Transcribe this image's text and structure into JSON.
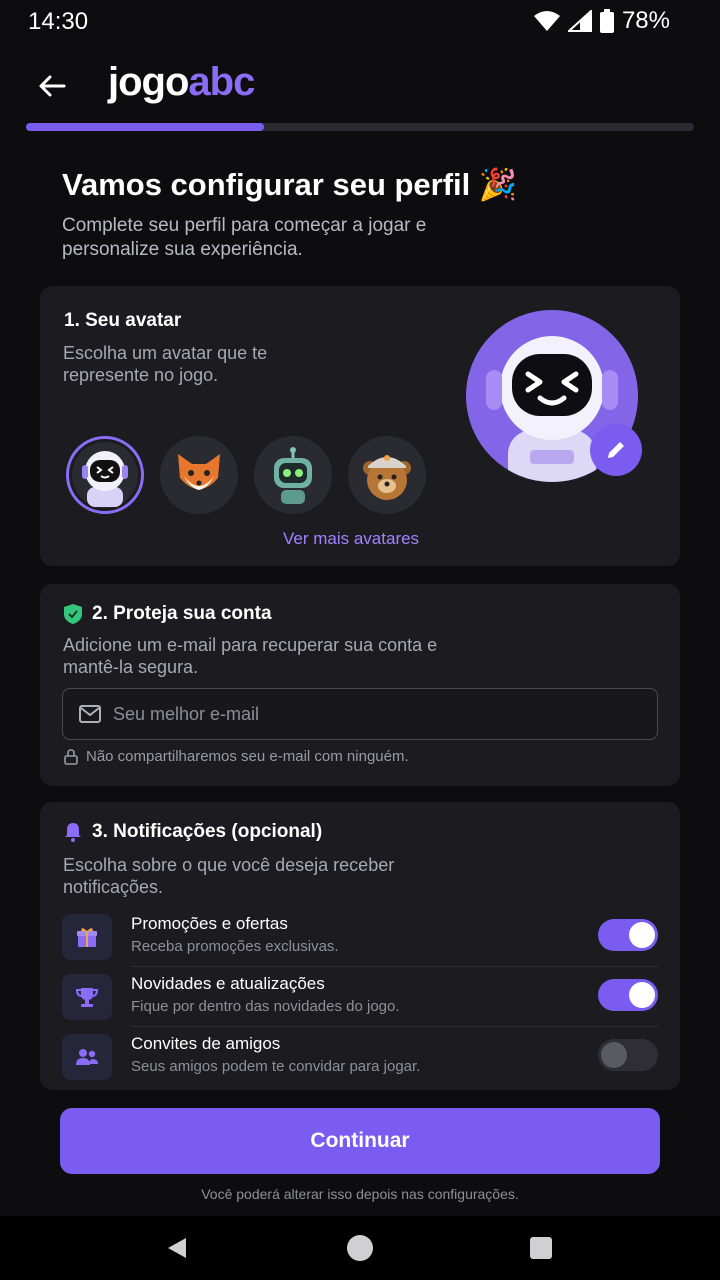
{
  "status_bar": {
    "time": "14:30",
    "battery": "78%",
    "icons": [
      "wifi-icon",
      "signal-icon",
      "battery-icon"
    ]
  },
  "header": {
    "logo_part1": "jogo",
    "logo_part2": "abc",
    "back_icon": "arrow-left-icon"
  },
  "progress": {
    "fraction": 0.356
  },
  "page": {
    "title": "Vamos configurar seu perfil 🎉",
    "subtitle": "Complete seu perfil para começar a jogar e personalize sua experiência."
  },
  "avatar_section": {
    "title": "1. Seu avatar",
    "description": "Escolha um avatar que te represente no jogo.",
    "options": [
      {
        "name": "astronaut",
        "selected": true
      },
      {
        "name": "fox",
        "selected": false
      },
      {
        "name": "robot",
        "selected": false
      },
      {
        "name": "bear",
        "selected": false
      }
    ],
    "more_link": "Ver mais avatares",
    "edit_icon": "pencil-icon"
  },
  "account_section": {
    "title": "2. Proteja sua conta",
    "description": "Adicione um e-mail para recuperar sua conta e mantê-la segura.",
    "email_placeholder": "Seu melhor e-mail",
    "email_value": "",
    "privacy_note": "Não compartilharemos seu e-mail com ninguém.",
    "icons": [
      "shield-icon",
      "mail-icon",
      "lock-icon"
    ]
  },
  "notifications_section": {
    "title": "3. Notificações (opcional)",
    "description": "Escolha sobre o que você deseja receber notificações.",
    "items": [
      {
        "label": "Promoções e ofertas",
        "sub": "Receba promoções exclusivas.",
        "enabled": true,
        "icon": "gift-icon"
      },
      {
        "label": "Novidades e atualizações",
        "sub": "Fique por dentro das novidades do jogo.",
        "enabled": true,
        "icon": "trophy-icon"
      },
      {
        "label": "Convites de amigos",
        "sub": "Seus amigos podem te convidar para jogar.",
        "enabled": false,
        "icon": "users-icon"
      }
    ]
  },
  "continue_button": "Continuar",
  "footer_note": "Você poderá alterar isso depois nas configurações.",
  "colors": {
    "accent": "#7b5cf0",
    "logo_accent": "#8b6cf6",
    "background": "#0d0d10",
    "card": "#1b1b20"
  }
}
